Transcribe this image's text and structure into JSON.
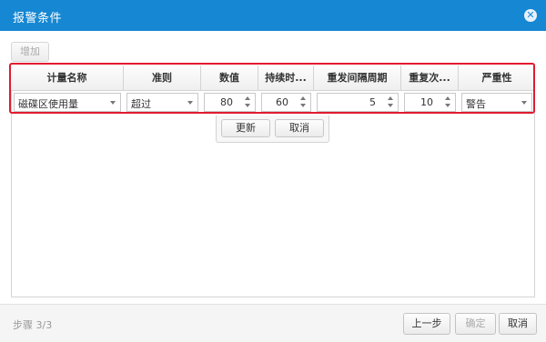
{
  "window": {
    "title": "报警条件",
    "close_glyph": "✕"
  },
  "toolbar": {
    "add_label": "增加"
  },
  "table": {
    "columns": [
      "计量名称",
      "准则",
      "数值",
      "持续时...",
      "重发间隔周期",
      "重复次...",
      "严重性"
    ],
    "row": {
      "metric": "磁碟区使用量",
      "criteria": "超过",
      "value": "80",
      "duration": "60",
      "resend_interval": "5",
      "repeat_count": "10",
      "severity": "警告"
    }
  },
  "row_editor": {
    "update_label": "更新",
    "cancel_label": "取消"
  },
  "footer": {
    "step_text": "步骤 3/3",
    "prev_label": "上一步",
    "confirm_label": "确定",
    "cancel_label": "取消"
  },
  "colors": {
    "titlebar": "#1587d3",
    "highlight_border": "#e01b2f"
  }
}
